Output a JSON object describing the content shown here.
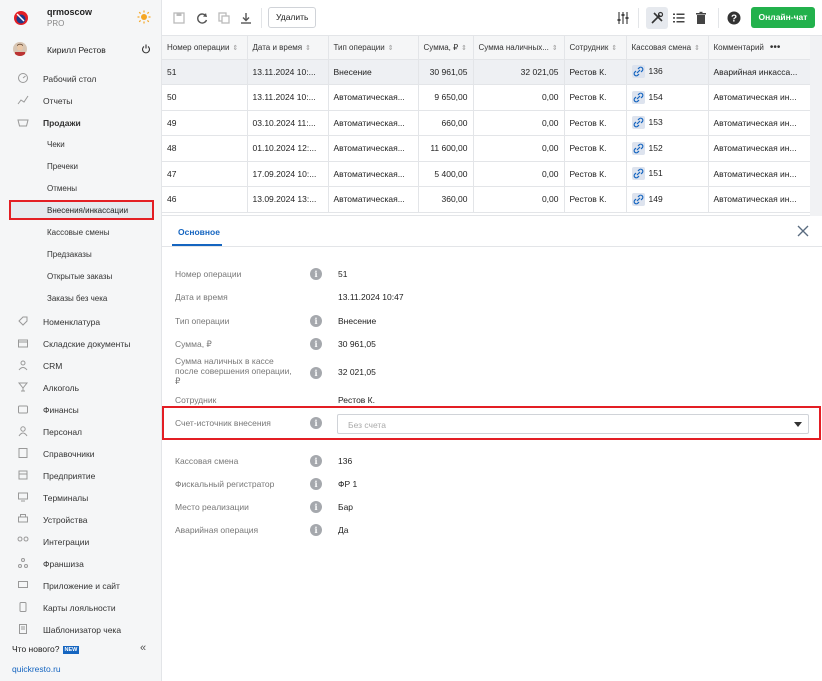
{
  "brand": {
    "name": "qrmoscow",
    "plan": "PRO"
  },
  "user": {
    "name": "Кирилл Рестов"
  },
  "nav": {
    "desktop": "Рабочий стол",
    "reports": "Отчеты",
    "sales": "Продажи",
    "sales_sub": [
      "Чеки",
      "Пречеки",
      "Отмены",
      "Внесения/инкассации",
      "Кассовые смены",
      "Предзаказы",
      "Открытые заказы",
      "Заказы без чека"
    ],
    "items": [
      "Номенклатура",
      "Складские документы",
      "CRM",
      "Алкоголь",
      "Финансы",
      "Персонал",
      "Справочники",
      "Предприятие",
      "Терминалы",
      "Устройства",
      "Интеграции",
      "Франшиза",
      "Приложение и сайт",
      "Карты лояльности",
      "Шаблонизатор чека"
    ]
  },
  "footer": {
    "whats_new": "Что нового?",
    "new_badge": "NEW",
    "site": "quickresto.ru"
  },
  "toolbar": {
    "delete_label": "Удалить",
    "chat_label": "Онлайн-чат"
  },
  "table": {
    "columns": [
      "Номер операции",
      "Дата и время",
      "Тип операции",
      "Сумма, ₽",
      "Сумма наличных...",
      "Сотрудник",
      "Кассовая смена",
      "Комментарий"
    ],
    "rows": [
      [
        "51",
        "13.11.2024 10:...",
        "Внесение",
        "30 961,05",
        "32 021,05",
        "Рестов К.",
        "136",
        "Аварийная инкасса..."
      ],
      [
        "50",
        "13.11.2024 10:...",
        "Автоматическая...",
        "9 650,00",
        "0,00",
        "Рестов К.",
        "154",
        "Автоматическая ин..."
      ],
      [
        "49",
        "03.10.2024 11:...",
        "Автоматическая...",
        "660,00",
        "0,00",
        "Рестов К.",
        "153",
        "Автоматическая ин..."
      ],
      [
        "48",
        "01.10.2024 12:...",
        "Автоматическая...",
        "11 600,00",
        "0,00",
        "Рестов К.",
        "152",
        "Автоматическая ин..."
      ],
      [
        "47",
        "17.09.2024 10:...",
        "Автоматическая...",
        "5 400,00",
        "0,00",
        "Рестов К.",
        "151",
        "Автоматическая ин..."
      ],
      [
        "46",
        "13.09.2024 13:...",
        "Автоматическая...",
        "360,00",
        "0,00",
        "Рестов К.",
        "149",
        "Автоматическая ин..."
      ]
    ]
  },
  "detail": {
    "tab": "Основное",
    "fields": [
      {
        "label": "Номер операции",
        "value": "51"
      },
      {
        "label": "Дата и время",
        "value": "13.11.2024 10:47"
      },
      {
        "label": "Тип операции",
        "value": "Внесение"
      },
      {
        "label": "Сумма, ₽",
        "value": "30 961,05"
      },
      {
        "label": "Сумма наличных в кассе после совершения операции, ₽",
        "value": "32 021,05"
      },
      {
        "label": "Сотрудник",
        "value": "Рестов К."
      },
      {
        "label": "Счет-источник внесения",
        "placeholder": "Без счета"
      },
      {
        "label": "Кассовая смена",
        "value": "136"
      },
      {
        "label": "Фискальный регистратор",
        "value": "ФР 1"
      },
      {
        "label": "Место реализации",
        "value": "Бар"
      },
      {
        "label": "Аварийная операция",
        "value": "Да"
      }
    ]
  },
  "colors": {
    "accent": "#1565c0",
    "highlight": "#e31e24",
    "chat": "#22b14c"
  },
  "icons": [
    "logo-icon",
    "sun-icon",
    "power-icon",
    "save-icon",
    "refresh-icon",
    "copy-icon",
    "download-icon",
    "settings-sliders-icon",
    "tools-icon",
    "list-icon",
    "trash-icon",
    "help-icon",
    "link-icon",
    "close-icon",
    "info-icon"
  ]
}
